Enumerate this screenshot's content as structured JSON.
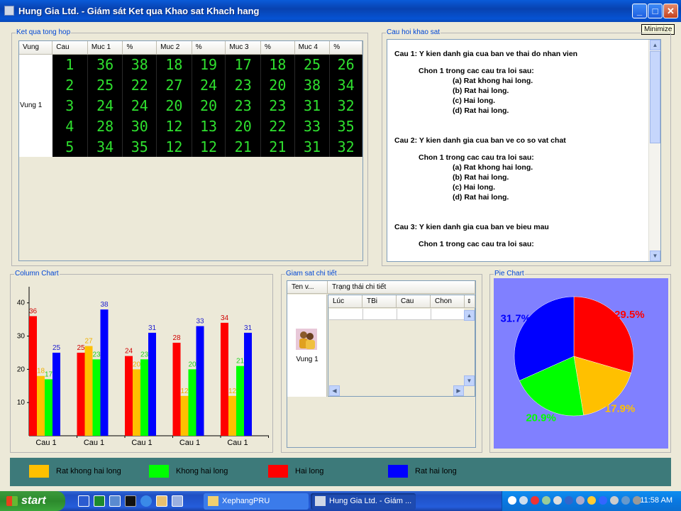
{
  "window": {
    "title": "Hung Gia Ltd.  - Giám sát Ket qua Khao sat Khach hang",
    "buttons": {
      "minimize": "_",
      "maximize": "□",
      "close": "✕"
    },
    "tooltip": "Minimize"
  },
  "summary": {
    "title": "Ket qua tong hop",
    "columns": [
      "Vung",
      "Cau",
      "Muc 1",
      "%",
      "Muc 2",
      "%",
      "Muc 3",
      "%",
      "Muc 4",
      "%"
    ],
    "region": "Vung 1",
    "rows": [
      [
        "1",
        "36",
        "38",
        "18",
        "19",
        "17",
        "18",
        "25",
        "26"
      ],
      [
        "2",
        "25",
        "22",
        "27",
        "24",
        "23",
        "20",
        "38",
        "34"
      ],
      [
        "3",
        "24",
        "24",
        "20",
        "20",
        "23",
        "23",
        "31",
        "32"
      ],
      [
        "4",
        "28",
        "30",
        "12",
        "13",
        "20",
        "22",
        "33",
        "35"
      ],
      [
        "5",
        "34",
        "35",
        "12",
        "12",
        "21",
        "21",
        "31",
        "32"
      ]
    ]
  },
  "questions": {
    "title": "Cau hoi khao sat",
    "lines": [
      {
        "text": "Cau 1: Y kien danh gia cua ban ve thai do nhan vien",
        "indent": 0,
        "gap": 0
      },
      {
        "text": "Chon 1 trong cac cau tra loi sau:",
        "indent": 1,
        "gap": 1
      },
      {
        "text": "(a) Rat khong hai long.",
        "indent": 2,
        "gap": 0
      },
      {
        "text": "(b) Rat hai long.",
        "indent": 2,
        "gap": 0
      },
      {
        "text": "(c) Hai long.",
        "indent": 2,
        "gap": 0
      },
      {
        "text": "(d) Rat hai long.",
        "indent": 2,
        "gap": 0
      },
      {
        "text": "Cau 2: Y kien danh gia cua ban ve co so vat chat",
        "indent": 0,
        "gap": 2
      },
      {
        "text": "Chon 1 trong cac cau tra loi sau:",
        "indent": 1,
        "gap": 1
      },
      {
        "text": "(a) Rat khong hai long.",
        "indent": 2,
        "gap": 0
      },
      {
        "text": "(b) Rat hai long.",
        "indent": 2,
        "gap": 0
      },
      {
        "text": "(c) Hai long.",
        "indent": 2,
        "gap": 0
      },
      {
        "text": "(d) Rat hai long.",
        "indent": 2,
        "gap": 0
      },
      {
        "text": "Cau 3: Y kien danh gia cua ban ve bieu mau",
        "indent": 0,
        "gap": 2
      },
      {
        "text": "Chon 1 trong cac cau tra loi sau:",
        "indent": 1,
        "gap": 1
      }
    ]
  },
  "column_chart": {
    "title": "Column Chart"
  },
  "monitor": {
    "title": "Giam sat chi tiết",
    "columns": [
      "Ten v...",
      "Trạng thái chi tiết"
    ],
    "inner_columns": [
      "Lúc",
      "TBi",
      "Cau",
      "Chon"
    ],
    "region": "Vung 1"
  },
  "pie": {
    "title": "Pie Chart"
  },
  "legend": [
    {
      "label": "Rat khong hai long",
      "color": "#ffc000"
    },
    {
      "label": "Khong hai long",
      "color": "#00ff00"
    },
    {
      "label": "Hai long",
      "color": "#ff0000"
    },
    {
      "label": "Rat hai long",
      "color": "#0000ff"
    }
  ],
  "taskbar": {
    "start": "start",
    "tasks": [
      "XephangPRU",
      "Hung Gia Ltd. - Giám ..."
    ],
    "clock": "11:58 AM"
  },
  "chart_data": [
    {
      "type": "bar",
      "categories": [
        "Cau 1",
        "Cau 1",
        "Cau 1",
        "Cau 1",
        "Cau 1"
      ],
      "series": [
        {
          "name": "Hai long",
          "color": "#ff0000",
          "label_color": "#d00000",
          "values": [
            36,
            25,
            24,
            28,
            34
          ]
        },
        {
          "name": "Rat khong hai long",
          "color": "#ffc000",
          "label_color": "#f0b000",
          "values": [
            18,
            27,
            20,
            12,
            12
          ]
        },
        {
          "name": "Khong hai long",
          "color": "#00ff00",
          "label_color": "#20d020",
          "values": [
            17,
            23,
            23,
            20,
            21
          ]
        },
        {
          "name": "Rat hai long",
          "color": "#0000ff",
          "label_color": "#2020d0",
          "values": [
            25,
            38,
            31,
            33,
            31
          ]
        }
      ],
      "yticks": [
        10,
        20,
        30,
        40
      ],
      "ylim": [
        0,
        44
      ]
    },
    {
      "type": "pie",
      "slices": [
        {
          "label": "29.5%",
          "value": 29.5,
          "color": "#ff0000",
          "label_color": "#ff0000"
        },
        {
          "label": "17.9%",
          "value": 17.9,
          "color": "#ffc000",
          "label_color": "#ffc000"
        },
        {
          "label": "20.9%",
          "value": 20.9,
          "color": "#00ff00",
          "label_color": "#00ff00"
        },
        {
          "label": "31.7%",
          "value": 31.7,
          "color": "#0000ff",
          "label_color": "#0000ff"
        }
      ]
    }
  ]
}
